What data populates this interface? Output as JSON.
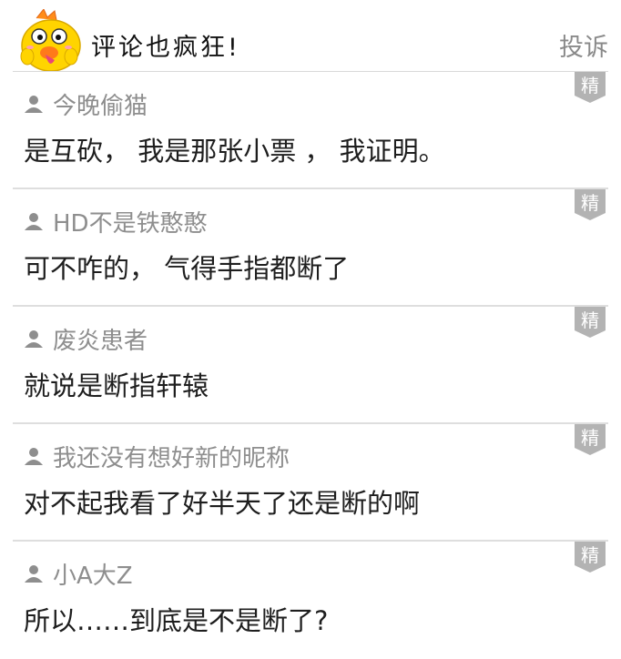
{
  "header": {
    "title": "评论也疯狂!",
    "report_label": "投诉"
  },
  "comments": [
    {
      "username": "今晚偷猫",
      "text": "是互砍， 我是那张小票 ， 我证明。",
      "badge": "精"
    },
    {
      "username": "HD不是铁憨憨",
      "text": "可不咋的， 气得手指都断了",
      "badge": "精"
    },
    {
      "username": "废炎患者",
      "text": "就说是断指轩辕",
      "badge": "精"
    },
    {
      "username": "我还没有想好新的昵称",
      "text": "对不起我看了好半天了还是断的啊",
      "badge": "精"
    },
    {
      "username": "小A大Z",
      "text": "所以……到底是不是断了?",
      "badge": "精"
    }
  ],
  "colors": {
    "badge_bg": "#b3b3b3",
    "username": "#8e8e8e",
    "mascot_yellow": "#ffd400"
  }
}
